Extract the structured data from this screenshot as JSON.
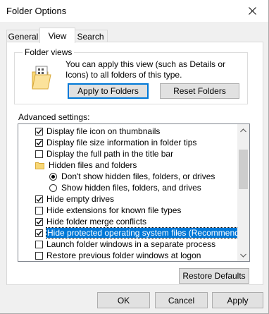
{
  "window": {
    "title": "Folder Options",
    "close_icon": "close-icon"
  },
  "tabs": [
    {
      "label": "General",
      "active": false
    },
    {
      "label": "View",
      "active": true
    },
    {
      "label": "Search",
      "active": false
    }
  ],
  "folder_views": {
    "legend": "Folder views",
    "description": "You can apply this view (such as Details or Icons) to all folders of this type.",
    "apply_label": "Apply to Folders",
    "reset_label": "Reset Folders"
  },
  "advanced": {
    "label": "Advanced settings:",
    "items": [
      {
        "kind": "checkbox",
        "checked": true,
        "label": "Display file icon on thumbnails"
      },
      {
        "kind": "checkbox",
        "checked": true,
        "label": "Display file size information in folder tips"
      },
      {
        "kind": "checkbox",
        "checked": false,
        "label": "Display the full path in the title bar"
      },
      {
        "kind": "folder",
        "label": "Hidden files and folders"
      },
      {
        "kind": "radio",
        "checked": true,
        "label": "Don't show hidden files, folders, or drives"
      },
      {
        "kind": "radio",
        "checked": false,
        "label": "Show hidden files, folders, and drives"
      },
      {
        "kind": "checkbox",
        "checked": true,
        "label": "Hide empty drives"
      },
      {
        "kind": "checkbox",
        "checked": false,
        "label": "Hide extensions for known file types"
      },
      {
        "kind": "checkbox",
        "checked": true,
        "label": "Hide folder merge conflicts"
      },
      {
        "kind": "checkbox",
        "checked": true,
        "label": "Hide protected operating system files (Recommended)",
        "selected": true
      },
      {
        "kind": "checkbox",
        "checked": false,
        "label": "Launch folder windows in a separate process"
      },
      {
        "kind": "checkbox",
        "checked": false,
        "label": "Restore previous folder windows at logon"
      }
    ],
    "restore_label": "Restore Defaults"
  },
  "footer": {
    "ok_label": "OK",
    "cancel_label": "Cancel",
    "apply_label": "Apply"
  },
  "colors": {
    "selection": "#0078d7",
    "folder": "#f8d775"
  }
}
